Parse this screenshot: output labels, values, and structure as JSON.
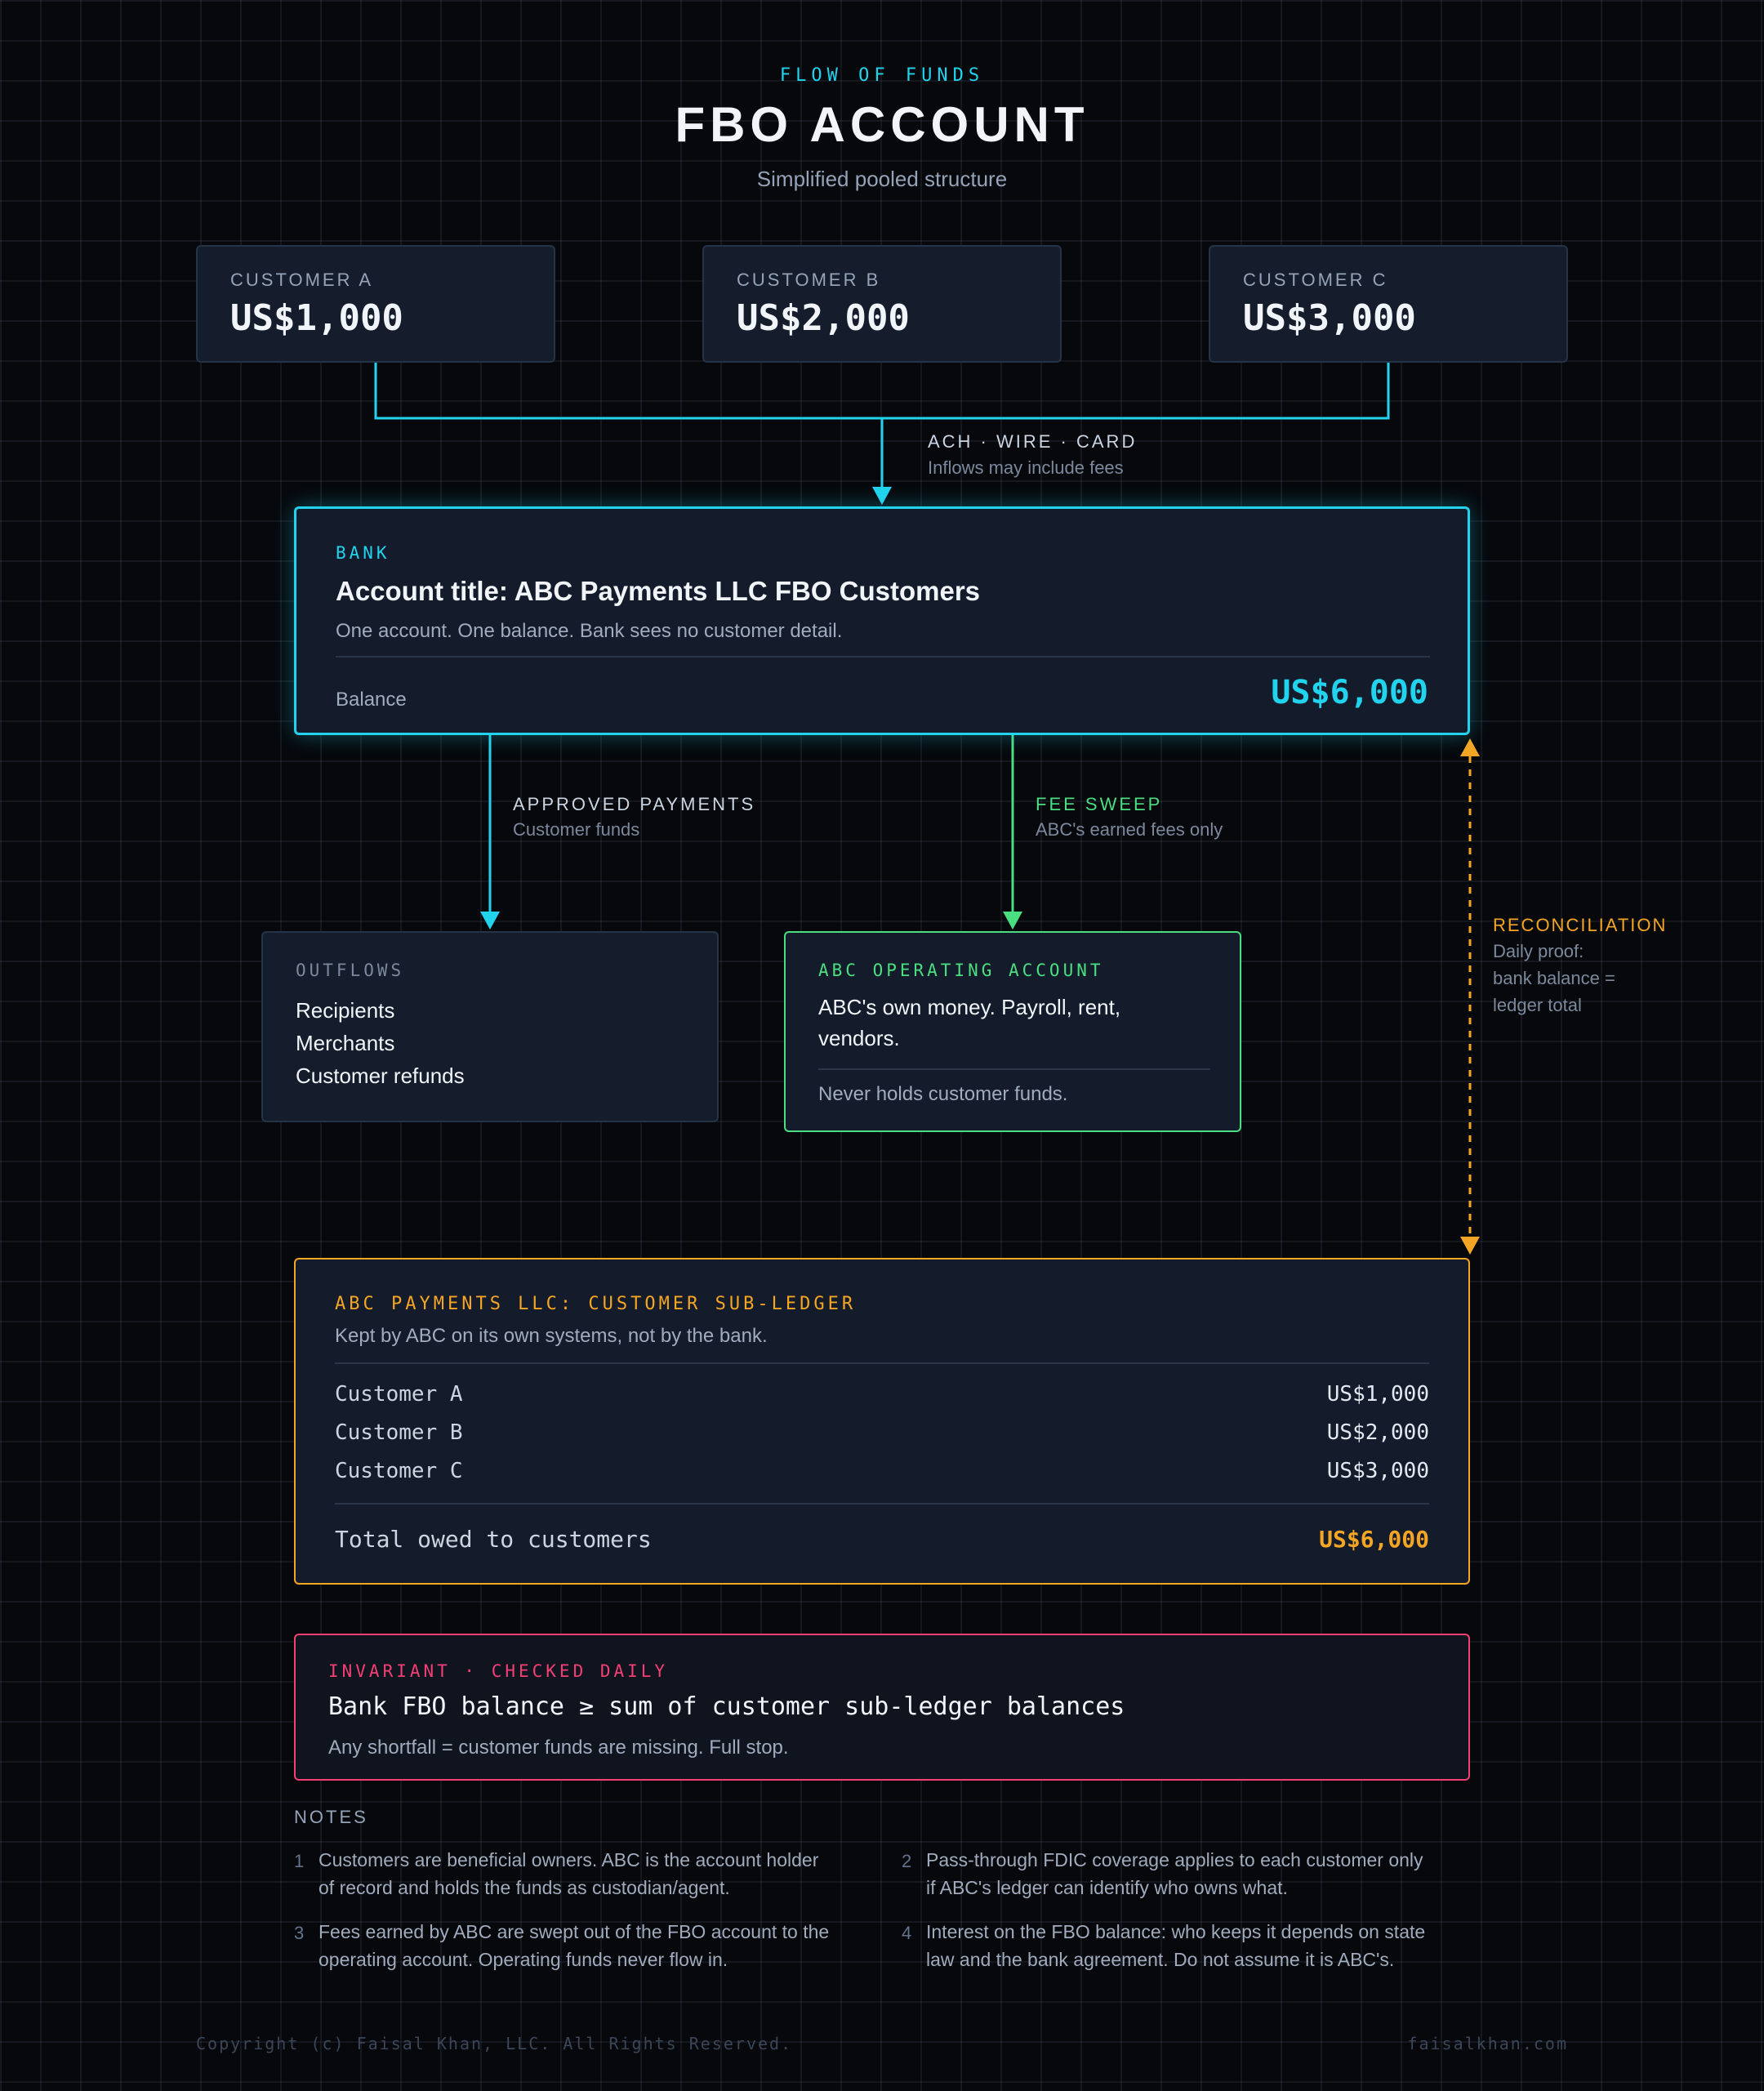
{
  "header": {
    "eyebrow": "FLOW OF FUNDS",
    "title": "FBO ACCOUNT",
    "subtitle": "Simplified pooled structure"
  },
  "customers": [
    {
      "label": "CUSTOMER A",
      "amount": "US$1,000"
    },
    {
      "label": "CUSTOMER B",
      "amount": "US$2,000"
    },
    {
      "label": "CUSTOMER C",
      "amount": "US$3,000"
    }
  ],
  "inflow": {
    "label": "ACH · WIRE · CARD",
    "sub": "Inflows may include fees"
  },
  "bank": {
    "tag": "BANK",
    "title": "Account title: ABC Payments LLC FBO Customers",
    "desc": "One account. One balance. Bank sees no customer detail.",
    "balance_label": "Balance",
    "balance": "US$6,000"
  },
  "approved": {
    "label": "APPROVED PAYMENTS",
    "sub": "Customer funds"
  },
  "fee_sweep": {
    "label": "FEE SWEEP",
    "sub": "ABC's earned fees only"
  },
  "reconciliation": {
    "label": "RECONCILIATION",
    "line1": "Daily proof:",
    "line2": "bank balance =",
    "line3": "ledger total"
  },
  "outflows": {
    "tag": "OUTFLOWS",
    "items": [
      "Recipients",
      "Merchants",
      "Customer refunds"
    ]
  },
  "operating": {
    "tag": "ABC OPERATING ACCOUNT",
    "line1": "ABC's own money. Payroll, rent,",
    "line2": "vendors.",
    "note": "Never holds customer funds."
  },
  "ledger": {
    "tag": "ABC PAYMENTS LLC: CUSTOMER SUB-LEDGER",
    "desc": "Kept by ABC on its own systems, not by the bank.",
    "rows": [
      {
        "name": "Customer A",
        "amount": "US$1,000"
      },
      {
        "name": "Customer B",
        "amount": "US$2,000"
      },
      {
        "name": "Customer C",
        "amount": "US$3,000"
      }
    ],
    "total_label": "Total owed to customers",
    "total": "US$6,000"
  },
  "invariant": {
    "tag": "INVARIANT · CHECKED DAILY",
    "rule": "Bank FBO balance ≥ sum of customer sub-ledger balances",
    "desc": "Any shortfall = customer funds are missing. Full stop."
  },
  "notes": {
    "heading": "NOTES",
    "items": [
      {
        "num": "1",
        "line1": "Customers are beneficial owners. ABC is the account holder",
        "line2": "of record and holds the funds as custodian/agent."
      },
      {
        "num": "2",
        "line1": "Pass-through FDIC coverage applies to each customer only",
        "line2": "if ABC's ledger can identify who owns what."
      },
      {
        "num": "3",
        "line1": "Fees earned by ABC are swept out of the FBO account to the",
        "line2": "operating account. Operating funds never flow in."
      },
      {
        "num": "4",
        "line1": "Interest on the FBO balance: who keeps it depends on state",
        "line2": "law and the bank agreement. Do not assume it is ABC's."
      }
    ]
  },
  "footer": {
    "copyright": "Copyright (c) Faisal Khan, LLC. All Rights Reserved.",
    "site": "faisalkhan.com"
  },
  "colors": {
    "cyan": "#22d3ee",
    "green": "#4ade80",
    "amber": "#f5a524",
    "pink": "#f43f74",
    "background": "#06080c"
  }
}
